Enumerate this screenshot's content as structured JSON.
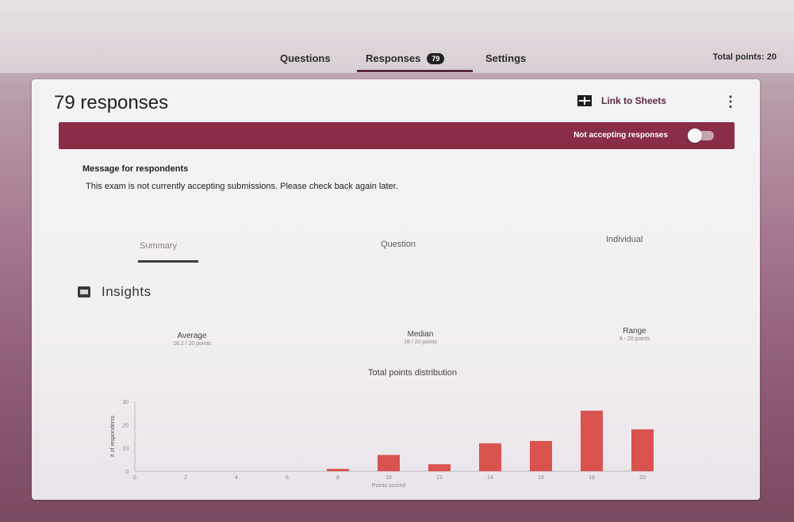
{
  "top_tabs": {
    "questions": "Questions",
    "responses": "Responses",
    "responses_badge": "79",
    "settings": "Settings",
    "total_points": "Total points: 20"
  },
  "card": {
    "title": "79 responses",
    "link_to_sheets": "Link to Sheets",
    "banner_label": "Not accepting responses",
    "message_title": "Message for respondents",
    "message_text": "This exam is not currently accepting submissions. Please check back again later.",
    "tabs": [
      "Summary",
      "Question",
      "Individual"
    ],
    "insights": "Insights",
    "stats": [
      {
        "title": "Average",
        "value": "16.2 / 20 points"
      },
      {
        "title": "Median",
        "value": "18 / 20 points"
      },
      {
        "title": "Range",
        "value": "9 - 20 points"
      }
    ]
  },
  "chart_data": {
    "type": "bar",
    "title": "Total points distribution",
    "xlabel": "Points scored",
    "ylabel": "# of respondents",
    "x_ticks": [
      "0",
      "2",
      "4",
      "6",
      "8",
      "10",
      "12",
      "14",
      "16",
      "18",
      "20"
    ],
    "y_ticks": [
      "0",
      "10",
      "20",
      "30"
    ],
    "ylim": [
      0,
      30
    ],
    "categories": [
      "8",
      "10",
      "12",
      "14",
      "16",
      "18",
      "20"
    ],
    "values": [
      1,
      7,
      3,
      12,
      13,
      26,
      18
    ],
    "color": "#d9534f"
  },
  "colors": {
    "accent": "#8a2d47",
    "bar": "#d9534f"
  }
}
